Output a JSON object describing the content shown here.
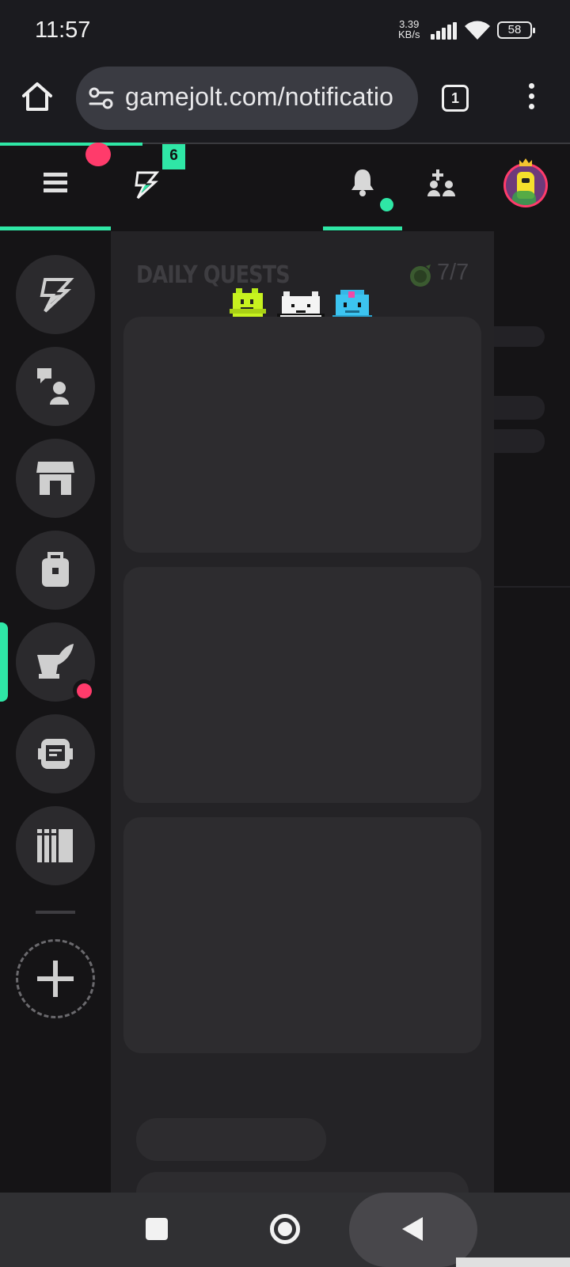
{
  "status_bar": {
    "time": "11:57",
    "net_speed_value": "3.39",
    "net_speed_unit": "KB/s",
    "battery": "58"
  },
  "browser": {
    "url": "gamejolt.com/notificatio",
    "tab_count": "1"
  },
  "gamejolt_topbar": {
    "activity_count": "6",
    "accent_color": "#2fe7a6",
    "alert_color": "#ff3b6b"
  },
  "sidebar": {
    "items": [
      {
        "name": "activity",
        "icon": "lightning-icon"
      },
      {
        "name": "chat",
        "icon": "chat-person-icon"
      },
      {
        "name": "shop",
        "icon": "store-icon"
      },
      {
        "name": "backpack",
        "icon": "backpack-icon"
      },
      {
        "name": "creator",
        "icon": "mortar-feather-icon",
        "has_alert": true
      },
      {
        "name": "bot",
        "icon": "robot-icon"
      },
      {
        "name": "library",
        "icon": "library-icon"
      },
      {
        "name": "add",
        "icon": "plus-icon"
      }
    ]
  },
  "main": {
    "quests_title": "DAILY QUESTS",
    "quests_progress": "7/7"
  }
}
